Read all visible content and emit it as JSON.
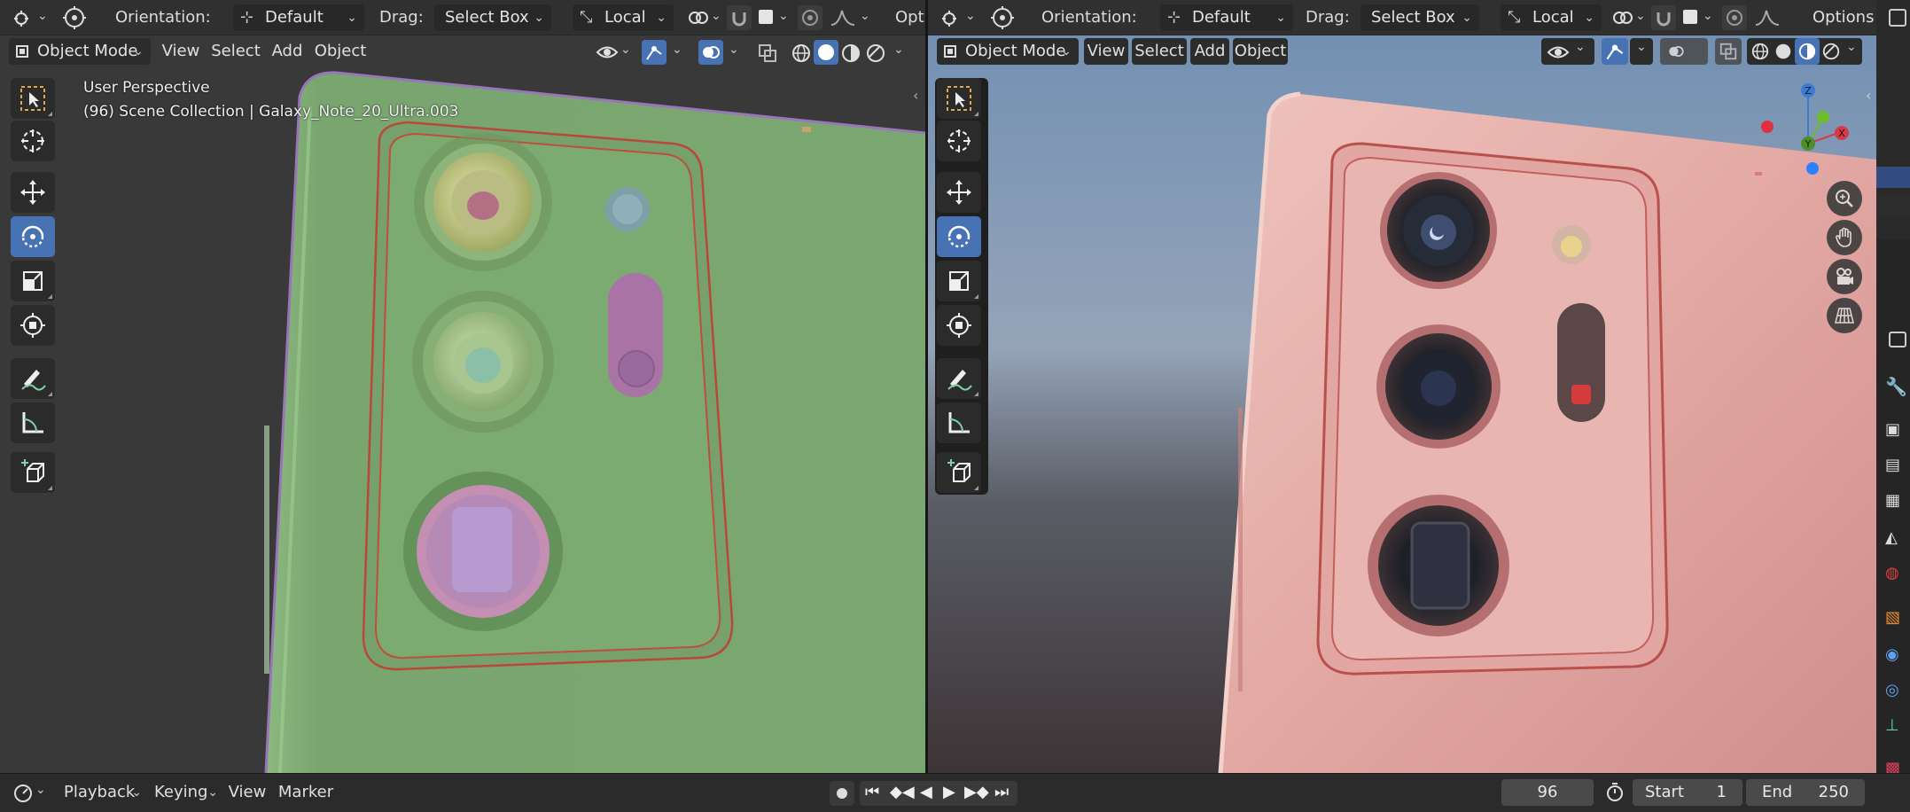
{
  "left_view": {
    "header": {
      "orientation_label": "Orientation:",
      "orientation_value": "Default",
      "drag_label": "Drag:",
      "drag_value": "Select Box",
      "pivot_value": "Local",
      "options_label": "Opti"
    },
    "menu": {
      "mode": "Object Mode",
      "view": "View",
      "select": "Select",
      "add": "Add",
      "object": "Object"
    },
    "overlay": {
      "perspective": "User Perspective",
      "collection": "(96) Scene Collection | Galaxy_Note_20_Ultra.003"
    },
    "shading": "solid",
    "colors": {
      "phone_body": "#7aa771",
      "outline": "#b9483a"
    }
  },
  "right_view": {
    "header": {
      "orientation_label": "Orientation:",
      "orientation_value": "Default",
      "drag_label": "Drag:",
      "drag_value": "Select Box",
      "pivot_value": "Local",
      "options_label": "Options"
    },
    "menu": {
      "mode": "Object Mode",
      "view": "View",
      "select": "Select",
      "add": "Add",
      "object": "Object"
    },
    "shading": "material-preview",
    "gizmo": {
      "x": "X",
      "y": "Y",
      "z": "Z"
    },
    "colors": {
      "phone_body": "#e3a8a3",
      "sky_top": "#7a96b6"
    }
  },
  "toolbar_tools": [
    "select-box-icon",
    "cursor-icon",
    "move-icon",
    "rotate-icon",
    "scale-icon",
    "transform-icon",
    "annotate-icon",
    "measure-icon",
    "add-cube-icon"
  ],
  "active_tool": "rotate-icon",
  "timeline": {
    "playback": "Playback",
    "keying": "Keying",
    "view": "View",
    "marker": "Marker",
    "current_frame": "96",
    "start_label": "Start",
    "start_value": "1",
    "end_label": "End",
    "end_value": "250"
  },
  "accent_color": "#4772b3"
}
